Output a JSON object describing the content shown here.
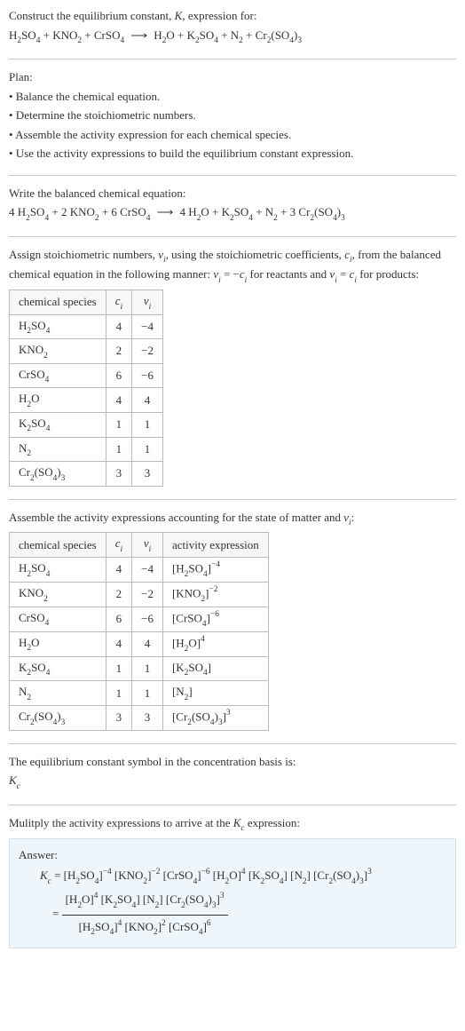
{
  "intro": {
    "line1_a": "Construct the equilibrium constant, ",
    "line1_b": ", expression for:",
    "eq_lhs_1": "H",
    "eq_lhs_1b": "SO",
    "eq_lhs_1c": " + KNO",
    "eq_lhs_1d": " + CrSO",
    "arrow": "⟶",
    "eq_rhs_1": "  H",
    "eq_rhs_1b": "O + K",
    "eq_rhs_1c": "SO",
    "eq_rhs_1d": " + N",
    "eq_rhs_1e": " + Cr",
    "eq_rhs_1f": "(SO",
    "eq_rhs_1g": ")"
  },
  "plan": {
    "title": "Plan:",
    "b1": "• Balance the chemical equation.",
    "b2": "• Determine the stoichiometric numbers.",
    "b3": "• Assemble the activity expression for each chemical species.",
    "b4": "• Use the activity expressions to build the equilibrium constant expression."
  },
  "balance": {
    "title": "Write the balanced chemical equation:",
    "c1": "4 H",
    "c2": "SO",
    "c3": " + 2 KNO",
    "c4": " + 6 CrSO",
    "r1": "  4 H",
    "r2": "O + K",
    "r3": "SO",
    "r4": " + N",
    "r5": " + 3 Cr",
    "r6": "(SO",
    "r7": ")"
  },
  "assign": {
    "p1": "Assign stoichiometric numbers, ",
    "p2": ", using the stoichiometric coefficients, ",
    "p3": ", from the balanced chemical equation in the following manner: ",
    "p4": " for reactants and ",
    "p5": " for products:",
    "eq_minus": " = −",
    "eq_eq": " = "
  },
  "species_headers": {
    "h1": "chemical species"
  },
  "species": [
    {
      "name_a": "H",
      "name_b": "SO",
      "s1": "2",
      "s2": "4",
      "c": "4",
      "v": "−4"
    },
    {
      "name_a": "KNO",
      "name_b": "",
      "s1": "2",
      "s2": "",
      "c": "2",
      "v": "−2"
    },
    {
      "name_a": "CrSO",
      "name_b": "",
      "s1": "4",
      "s2": "",
      "c": "6",
      "v": "−6"
    },
    {
      "name_a": "H",
      "name_b": "O",
      "s1": "2",
      "s2": "",
      "c": "4",
      "v": "4"
    },
    {
      "name_a": "K",
      "name_b": "SO",
      "s1": "2",
      "s2": "4",
      "c": "1",
      "v": "1"
    },
    {
      "name_a": "N",
      "name_b": "",
      "s1": "2",
      "s2": "",
      "c": "1",
      "v": "1"
    },
    {
      "name_a": "Cr",
      "name_b": "(SO",
      "name_c": ")",
      "s1": "2",
      "s2": "4",
      "s3": "3",
      "c": "3",
      "v": "3"
    }
  ],
  "activity": {
    "title_a": "Assemble the activity expressions accounting for the state of matter and ",
    "title_b": ":",
    "h4": "activity expression"
  },
  "activity_rows": [
    {
      "b": "[H",
      "s1": "2",
      "m": "SO",
      "s2": "4",
      "e": "]",
      "exp": "−4"
    },
    {
      "b": "[KNO",
      "s1": "2",
      "e": "]",
      "exp": "−2"
    },
    {
      "b": "[CrSO",
      "s1": "4",
      "e": "]",
      "exp": "−6"
    },
    {
      "b": "[H",
      "s1": "2",
      "m": "O]",
      "exp": "4"
    },
    {
      "b": "[K",
      "s1": "2",
      "m": "SO",
      "s2": "4",
      "e": "]"
    },
    {
      "b": "[N",
      "s1": "2",
      "e": "]"
    },
    {
      "b": "[Cr",
      "s1": "2",
      "m": "(SO",
      "s2": "4",
      "m2": ")",
      "s3": "3",
      "e": "]",
      "exp": "3"
    }
  ],
  "symbol": {
    "line1": "The equilibrium constant symbol in the concentration basis is:"
  },
  "final": {
    "title": "Mulitply the activity expressions to arrive at the ",
    "title2": " expression:",
    "answer": "Answer:",
    "eq": " = ",
    "t_h2so4": "[H",
    "t_so4": "SO",
    "t_close": "]",
    "t_kno2": " [KNO",
    "t_crso4": " [CrSO",
    "t_h2o": " [H",
    "t_o": "O]",
    "t_k2so4": " [K",
    "t_n2": " [N",
    "t_cr2": " [Cr",
    "t_open": "(SO",
    "t_paren": ")",
    "exp_m4": "−4",
    "exp_m2": "−2",
    "exp_m6": "−6",
    "exp_4": "4",
    "exp_3": "3",
    "exp_2": "2",
    "exp_6": "6",
    "s2": "2",
    "s4": "4",
    "s3": "3",
    "eq2": " = "
  }
}
